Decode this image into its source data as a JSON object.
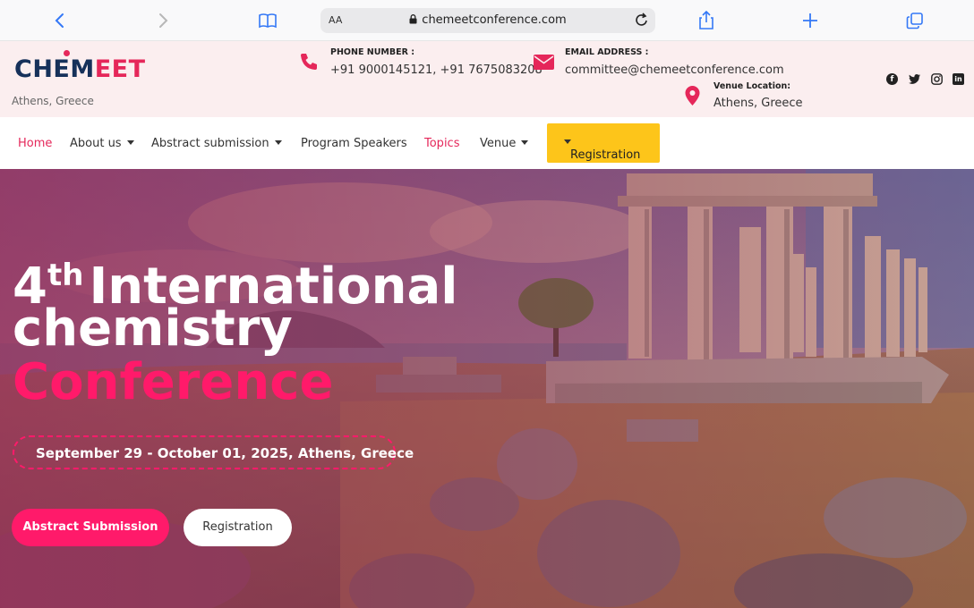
{
  "browser": {
    "text_size_label": "AA",
    "url": "chemeetconference.com",
    "icons": [
      "back-icon",
      "forward-icon",
      "bookmarks-icon",
      "lock-icon",
      "reload-icon",
      "share-icon",
      "new-tab-icon",
      "tabs-icon"
    ]
  },
  "header": {
    "logo_part1": "CHEM",
    "logo_part2": "EET",
    "location_sub": "Athens, Greece",
    "phone_label": "PHONE NUMBER :",
    "phone_value": "+91 9000145121, +91 7675083208",
    "email_label": "EMAIL ADDRESS :",
    "email_value": "committee@chemeetconference.com",
    "venue_label": "Venue Location:",
    "venue_value": "Athens, Greece",
    "social_icons": [
      "facebook-icon",
      "twitter-icon",
      "instagram-icon",
      "linkedin-icon"
    ]
  },
  "nav": {
    "items": [
      {
        "label": "Home",
        "active": true,
        "dropdown": false
      },
      {
        "label": "About us",
        "active": false,
        "dropdown": true
      },
      {
        "label": "Abstract submission",
        "active": false,
        "dropdown": true
      },
      {
        "label": "Program Speakers",
        "active": false,
        "dropdown": false
      },
      {
        "label": "Topics",
        "active": true,
        "dropdown": false
      },
      {
        "label": "Venue",
        "active": false,
        "dropdown": true
      }
    ],
    "registration_label": "Registration"
  },
  "hero": {
    "title_ordinal": "4",
    "title_sup": "th",
    "title_line1_rest": "International",
    "title_line2": "chemistry",
    "title_line3": "Conference",
    "date_text": "September 29 - October 01, 2025, Athens, Greece",
    "btn_abstract": "Abstract Submission",
    "btn_registration": "Registration"
  },
  "colors": {
    "accent": "#e5275a",
    "hero_accent": "#ff1a6a",
    "logo_navy": "#16315a",
    "registration_yellow": "#fdc51a",
    "header_bg": "#fbeeef"
  }
}
